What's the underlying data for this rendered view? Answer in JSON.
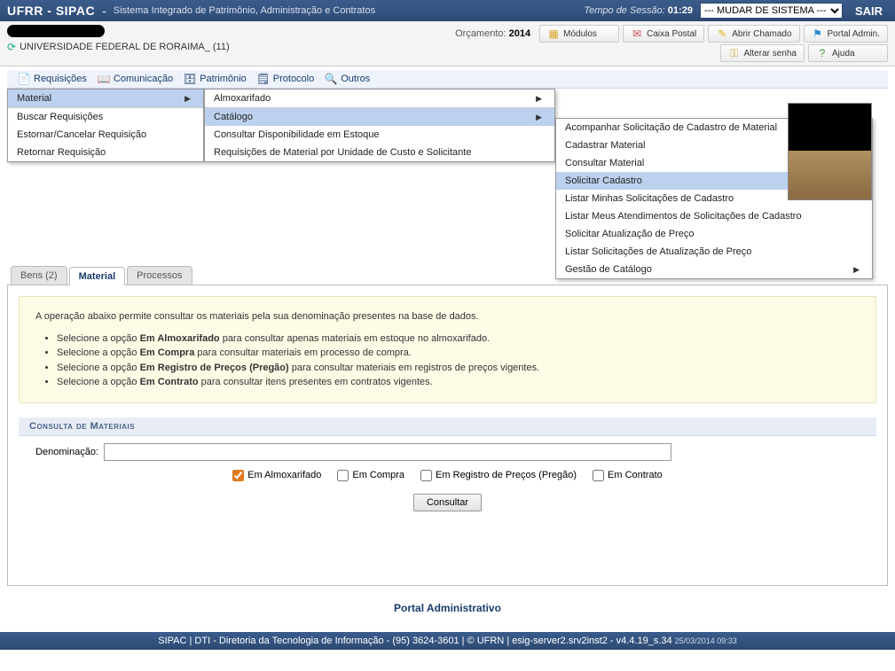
{
  "header": {
    "title": "UFRR - SIPAC",
    "subtitle": "Sistema Integrado de Patrimônio, Administração e Contratos",
    "session_label": "Tempo de Sessão:",
    "session_time": "01:29",
    "system_select": "--- MUDAR DE SISTEMA ---",
    "exit": "SAIR"
  },
  "infobar": {
    "org": "UNIVERSIDADE FEDERAL DE RORAIMA_ (11)",
    "budget_label": "Orçamento:",
    "budget_year": "2014",
    "buttons": {
      "modulos": "Módulos",
      "caixa": "Caixa Postal",
      "chamado": "Abrir Chamado",
      "portal": "Portal Admin.",
      "senha": "Alterar senha",
      "ajuda": "Ajuda"
    }
  },
  "menubar": {
    "requisicoes": "Requisições",
    "comunicacao": "Comunicação",
    "patrimonio": "Patrimônio",
    "protocolo": "Protocolo",
    "outros": "Outros"
  },
  "submenu1": {
    "material": "Material",
    "buscar": "Buscar Requisições",
    "estornar": "Estornar/Cancelar Requisição",
    "retornar": "Retornar Requisição"
  },
  "submenu2": {
    "almox": "Almoxarifado",
    "catalogo": "Catálogo",
    "disponibilidade": "Consultar Disponibilidade em Estoque",
    "reqmat": "Requisições de Material por Unidade de Custo e Solicitante"
  },
  "submenu3": {
    "acompanhar": "Acompanhar Solicitação de Cadastro de Material",
    "cadastrar": "Cadastrar Material",
    "consultar": "Consultar Material",
    "solicitar": "Solicitar Cadastro",
    "listar_minhas": "Listar Minhas Solicitações de Cadastro",
    "listar_atend": "Listar Meus Atendimentos de Solicitações de Cadastro",
    "atualizacao": "Solicitar Atualização de Preço",
    "listar_atual": "Listar Solicitações de Atualização de Preço",
    "gestao": "Gestão de Catálogo"
  },
  "tabs": {
    "bens": "Bens (2)",
    "material": "Material",
    "processos": "Processos"
  },
  "yellowbox": {
    "intro": "A operação abaixo permite consultar os materiais pela sua denominação presentes na base de dados.",
    "l1a": "Selecione a opção ",
    "l1b": "Em Almoxarifado",
    "l1c": " para consultar apenas materiais em estoque no almoxarifado.",
    "l2a": "Selecione a opção ",
    "l2b": "Em Compra",
    "l2c": " para consultar materiais em processo de compra.",
    "l3a": "Selecione a opção ",
    "l3b": "Em Registro de Preços (Pregão)",
    "l3c": " para consultar materiais em registros de preços vigentes.",
    "l4a": "Selecione a opção ",
    "l4b": "Em Contrato",
    "l4c": " para consultar itens presentes em contratos vigentes."
  },
  "form": {
    "title": "Consulta de Materiais",
    "denom_label": "Denominação:",
    "chk_almox": "Em Almoxarifado",
    "chk_compra": "Em Compra",
    "chk_registro": "Em Registro de Preços (Pregão)",
    "chk_contrato": "Em Contrato",
    "submit": "Consultar"
  },
  "portal_link": "Portal Administrativo",
  "footer": {
    "text": "SIPAC | DTI - Diretoria da Tecnologia de Informação - (95) 3624-3601 | © UFRN | esig-server2.srv2inst2 - v4.4.19_s.34",
    "date": "25/03/2014 09:33"
  }
}
